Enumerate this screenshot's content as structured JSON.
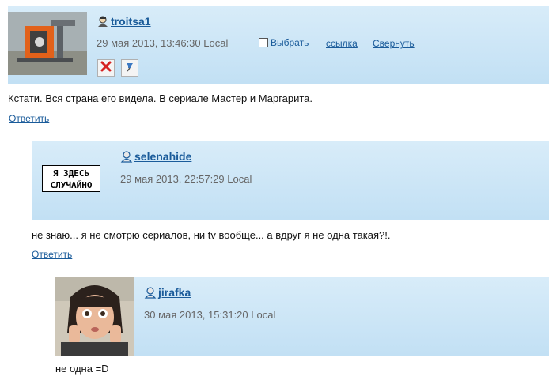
{
  "comments": [
    {
      "username": "troitsa1",
      "date": "29 мая 2013, 13:46:30 Local",
      "select_label": "Выбрать",
      "link_label": "ссылка",
      "collapse_label": "Свернуть",
      "text": "Кстати. Вся страна его видела. В сериале Мастер и Маргарита.",
      "reply_label": "Ответить"
    },
    {
      "username": "selenahide",
      "avatar_text_line1": "Я ЗДЕСЬ",
      "avatar_text_line2": "СЛУЧАЙНО",
      "date": "29 мая 2013, 22:57:29 Local",
      "text": "не знаю... я не смотрю сериалов, ни tv вообще... а вдруг я не одна такая?!.",
      "reply_label": "Ответить"
    },
    {
      "username": "jirafka",
      "date": "30 мая 2013, 15:31:20 Local",
      "text": "не одна =D"
    }
  ],
  "colors": {
    "header_bg": "#c9e5f7",
    "link": "#1a5b9a",
    "delete_red": "#d62222",
    "pin_blue": "#3b78c2"
  }
}
